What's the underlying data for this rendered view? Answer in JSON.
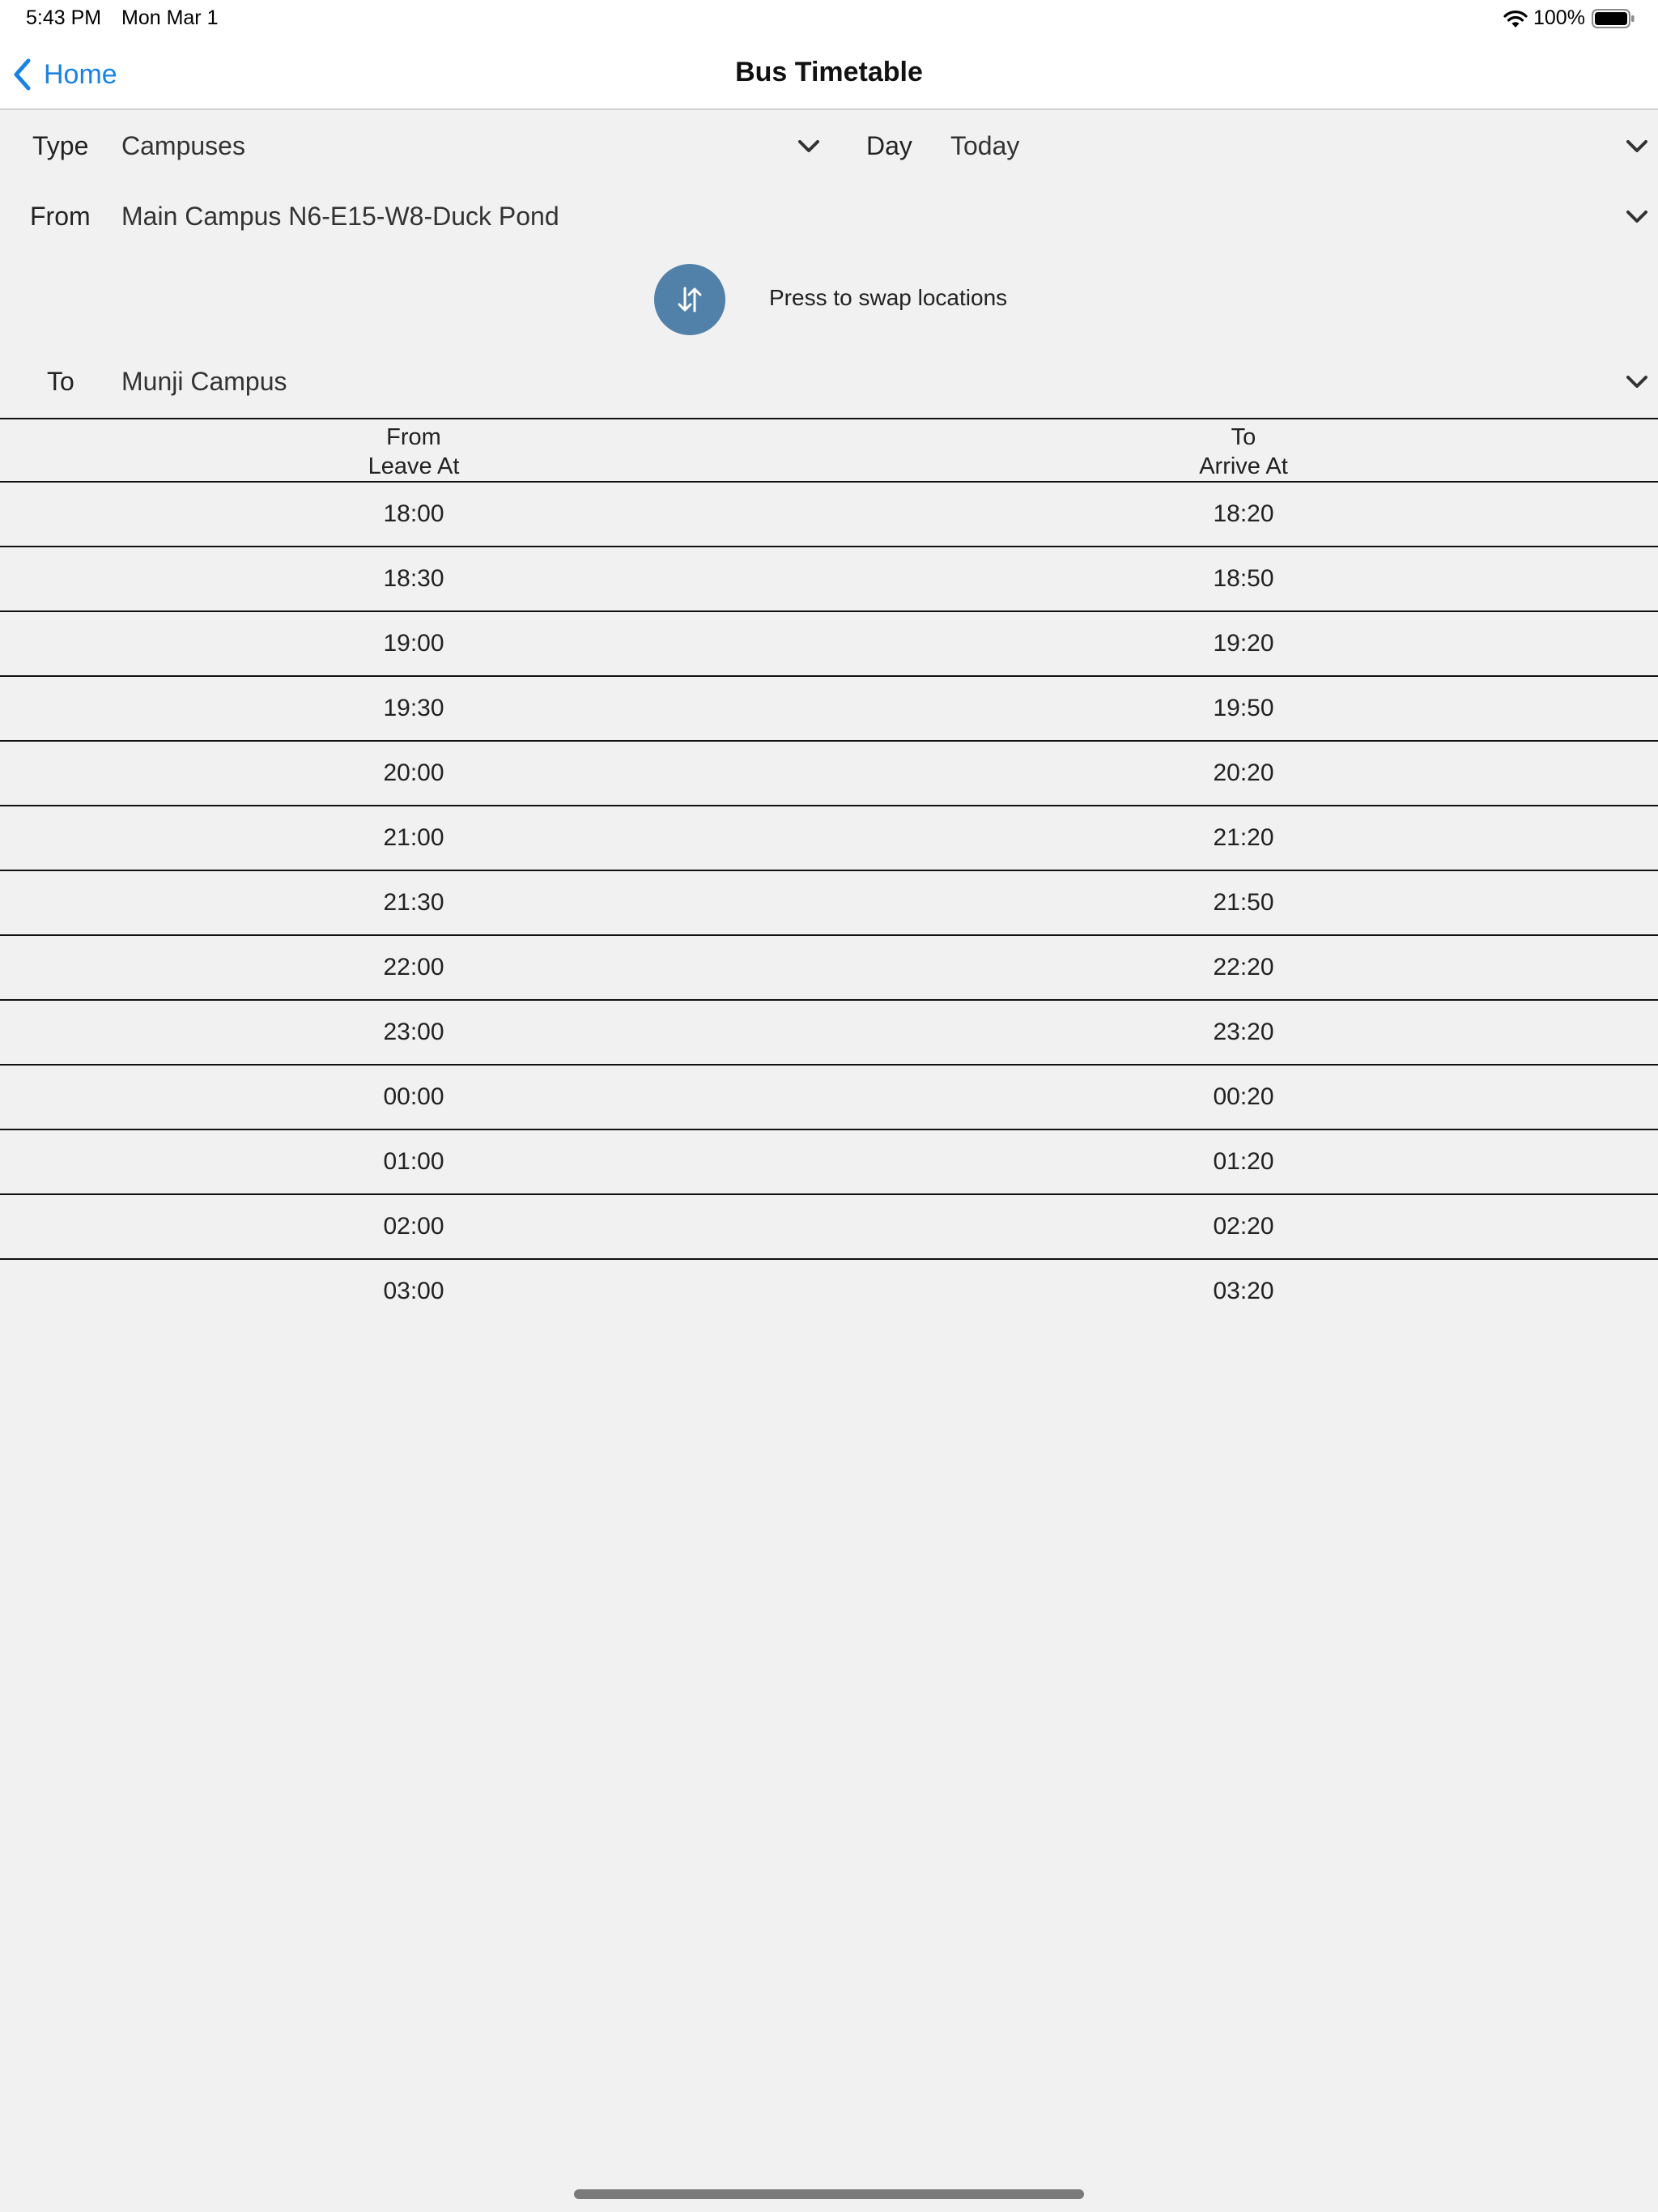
{
  "status_bar": {
    "time": "5:43 PM",
    "date": "Mon Mar 1",
    "battery": "100%"
  },
  "nav": {
    "back_label": "Home",
    "title": "Bus Timetable"
  },
  "form": {
    "type_label": "Type",
    "type_value": "Campuses",
    "day_label": "Day",
    "day_value": "Today",
    "from_label": "From",
    "from_value": "Main Campus N6-E15-W8-Duck Pond",
    "swap_hint": "Press to swap locations",
    "to_label": "To",
    "to_value": "Munji Campus"
  },
  "table": {
    "header_left_line1": "From",
    "header_left_line2": "Leave At",
    "header_right_line1": "To",
    "header_right_line2": "Arrive At",
    "rows": [
      {
        "leave": "18:00",
        "arrive": "18:20"
      },
      {
        "leave": "18:30",
        "arrive": "18:50"
      },
      {
        "leave": "19:00",
        "arrive": "19:20"
      },
      {
        "leave": "19:30",
        "arrive": "19:50"
      },
      {
        "leave": "20:00",
        "arrive": "20:20"
      },
      {
        "leave": "21:00",
        "arrive": "21:20"
      },
      {
        "leave": "21:30",
        "arrive": "21:50"
      },
      {
        "leave": "22:00",
        "arrive": "22:20"
      },
      {
        "leave": "23:00",
        "arrive": "23:20"
      },
      {
        "leave": "00:00",
        "arrive": "00:20"
      },
      {
        "leave": "01:00",
        "arrive": "01:20"
      },
      {
        "leave": "02:00",
        "arrive": "02:20"
      },
      {
        "leave": "03:00",
        "arrive": "03:20"
      }
    ]
  },
  "colors": {
    "accent": "#1a82e2",
    "swap_button": "#5180a8",
    "background": "#f1f1f1"
  },
  "icons": {
    "back": "chevron-left-icon",
    "dropdown": "chevron-down-icon",
    "swap": "swap-vertical-icon",
    "wifi": "wifi-icon",
    "battery": "battery-icon"
  }
}
